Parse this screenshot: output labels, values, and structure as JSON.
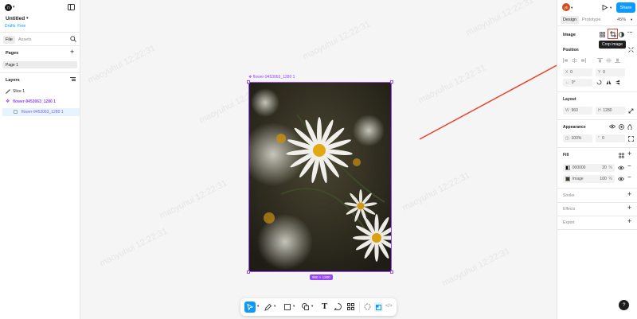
{
  "left": {
    "avatar_letter": "n",
    "file_name": "Untitled",
    "drafts": "Drafts",
    "plan": "Free",
    "tab_file": "File",
    "tab_assets": "Assets",
    "pages_title": "Pages",
    "page1": "Page 1",
    "layers_title": "Layers",
    "layer1": "Slice 1",
    "layer2": "flower-9453063_1280 1",
    "layer3": "flower-9453063_1280 1"
  },
  "canvas": {
    "frame_label": "flower-9453063_1280 1",
    "size_badge": "960 × 1280",
    "watermark": "maoyuhui 12:22:31"
  },
  "right": {
    "avatar_letter": "yh",
    "share": "Share",
    "tab_design": "Design",
    "tab_prototype": "Prototype",
    "zoom": "45%",
    "image_title": "Image",
    "tooltip": "Crop image",
    "position_title": "Position",
    "x_label": "X",
    "x_val": "0",
    "y_label": "Y",
    "y_val": "0",
    "rot_val": "0°",
    "layout_title": "Layout",
    "w_label": "W",
    "w_val": "960",
    "h_label": "H",
    "h_val": "1280",
    "appearance_title": "Appearance",
    "opacity": "100%",
    "radius": "0",
    "fill_title": "Fill",
    "fill1_hex": "000000",
    "fill1_pct": "20",
    "fill2_name": "Image",
    "fill2_pct": "100",
    "pct": "%",
    "stroke_title": "Stroke",
    "effects_title": "Effects",
    "export_title": "Export",
    "help": "?"
  },
  "colors": {
    "accent": "#0d99ff",
    "purple": "#9747ff",
    "red": "#e8432f"
  }
}
